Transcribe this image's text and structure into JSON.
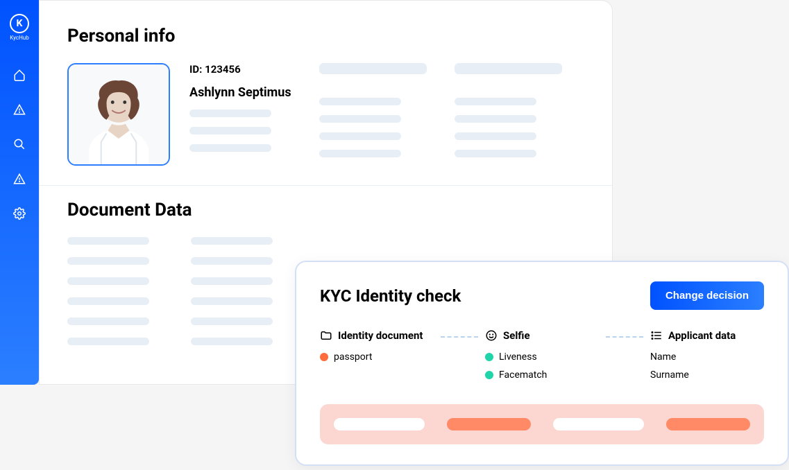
{
  "brand": {
    "name": "KycHub"
  },
  "sidebar": {
    "items": [
      "home",
      "alert-1",
      "search",
      "alert-2",
      "settings"
    ]
  },
  "personal_info": {
    "title": "Personal info",
    "id_label": "ID: 123456",
    "name": "Ashlynn Septimus"
  },
  "document_data": {
    "title": "Document Data"
  },
  "kyc": {
    "title": "KYC Identity check",
    "button": "Change decision",
    "sections": {
      "identity": {
        "label": "Identity document",
        "items": [
          {
            "label": "passport",
            "status": "orange"
          }
        ]
      },
      "selfie": {
        "label": "Selfie",
        "items": [
          {
            "label": "Liveness",
            "status": "teal"
          },
          {
            "label": "Facematch",
            "status": "teal"
          }
        ]
      },
      "applicant": {
        "label": "Applicant data",
        "items": [
          {
            "label": "Name"
          },
          {
            "label": "Surname"
          }
        ]
      }
    }
  }
}
